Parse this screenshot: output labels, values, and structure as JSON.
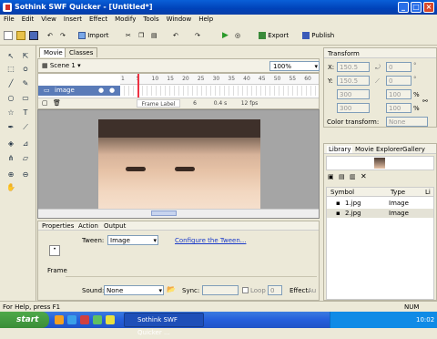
{
  "window": {
    "title": "Sothink SWF Quicker - [Untitled*]",
    "controls": [
      "_",
      "□",
      "×"
    ]
  },
  "menubar": [
    "File",
    "Edit",
    "View",
    "Insert",
    "Effect",
    "Modify",
    "Tools",
    "Window",
    "Help"
  ],
  "toolbar": {
    "import_label": "Import",
    "export_label": "Export",
    "publish_label": "Publish"
  },
  "doc_tabs": [
    "Movie",
    "Classes"
  ],
  "scene": {
    "name": "Scene 1",
    "zoom": "100%"
  },
  "timeline": {
    "layer_name": "image",
    "ruler_ticks": [
      "1",
      "5",
      "10",
      "15",
      "20",
      "25",
      "30",
      "35",
      "40",
      "45",
      "50",
      "55",
      "60"
    ],
    "frame_label": "Frame Label",
    "current_frame": "6",
    "time": "0.4 s",
    "fps": "12 fps"
  },
  "properties": {
    "tabs": [
      "Properties",
      "Action",
      "Output"
    ],
    "frame_label": "Frame",
    "tween_label": "Tween:",
    "tween_value": "Image",
    "configure_link": "Configure the Tween...",
    "sound_label": "Sound:",
    "sound_value": "None",
    "sync_label": "Sync:",
    "loop_label": "Loop",
    "loop_value": "0",
    "effect_label": "Effect:",
    "effect_value": "Au"
  },
  "transform": {
    "title": "Transform",
    "x_label": "X:",
    "x_value": "150.5",
    "y_label": "Y:",
    "y_value": "150.5",
    "w_value": "300",
    "h_value": "300",
    "pct1": "%",
    "pct2": "%",
    "deg1": "°",
    "deg2": "°",
    "rot_value": "0",
    "skew_value": "0",
    "scale_x": "100",
    "scale_y": "100",
    "color_transform_label": "Color transform:",
    "color_transform_value": "None"
  },
  "library": {
    "tabs": [
      "Library",
      "Movie Explorer",
      "Gallery"
    ],
    "columns": [
      "Symbol",
      "Type",
      "Li"
    ],
    "items": [
      {
        "name": "1.jpg",
        "type": "Image"
      },
      {
        "name": "2.jpg",
        "type": "Image"
      }
    ]
  },
  "status": {
    "help": "For Help, press F1",
    "num": "NUM"
  },
  "taskbar": {
    "start": "start",
    "app_button": "Sothink SWF Quicker ...",
    "clock": "10:02"
  }
}
